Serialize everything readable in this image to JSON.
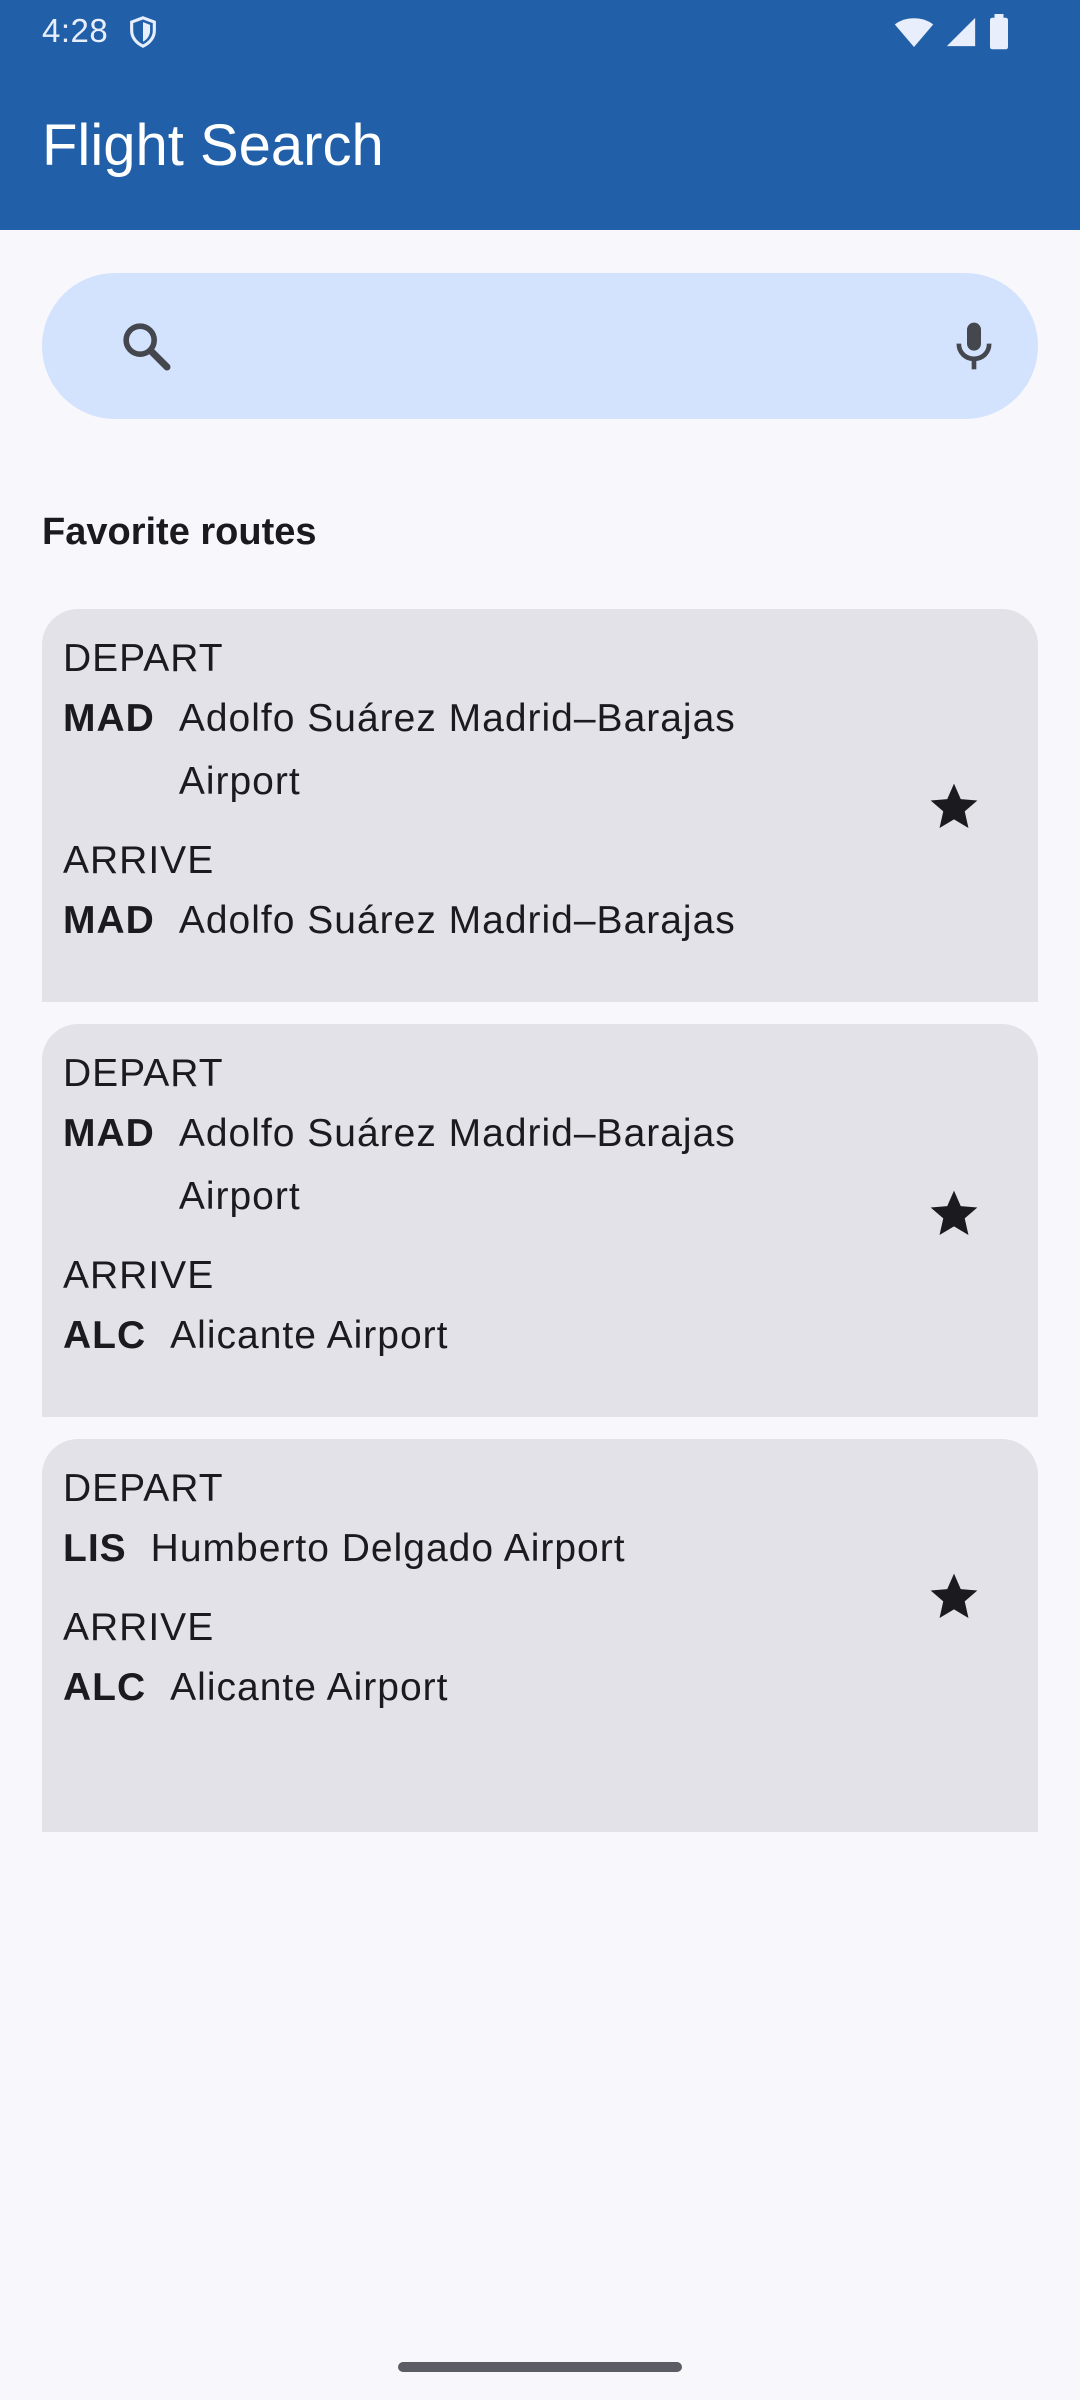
{
  "status_bar": {
    "time": "4:28"
  },
  "app_bar": {
    "title": "Flight Search"
  },
  "search": {
    "value": "",
    "placeholder": ""
  },
  "favorites": {
    "title": "Favorite routes",
    "routes": [
      {
        "depart_label": "DEPART",
        "depart_code": "MAD",
        "depart_name": "Adolfo Suárez Madrid–Barajas Airport",
        "arrive_label": "ARRIVE",
        "arrive_code": "MAD",
        "arrive_name": "Adolfo Suárez Madrid–Barajas"
      },
      {
        "depart_label": "DEPART",
        "depart_code": "MAD",
        "depart_name": "Adolfo Suárez Madrid–Barajas Airport",
        "arrive_label": "ARRIVE",
        "arrive_code": "ALC",
        "arrive_name": "Alicante Airport"
      },
      {
        "depart_label": "DEPART",
        "depart_code": "LIS",
        "depart_name": "Humberto Delgado Airport",
        "arrive_label": "ARRIVE",
        "arrive_code": "ALC",
        "arrive_name": "Alicante Airport"
      }
    ]
  },
  "icons": {
    "status": [
      "shield-icon",
      "wifi-icon",
      "signal-icon",
      "battery-icon"
    ],
    "search": "search-icon",
    "mic": "mic-icon",
    "favorite": "star-icon"
  },
  "colors": {
    "app_bar": "#2160a8",
    "search_bg": "#d3e3fd",
    "card_bg": "#e3e2e8",
    "page_bg": "#f7f7fc"
  }
}
